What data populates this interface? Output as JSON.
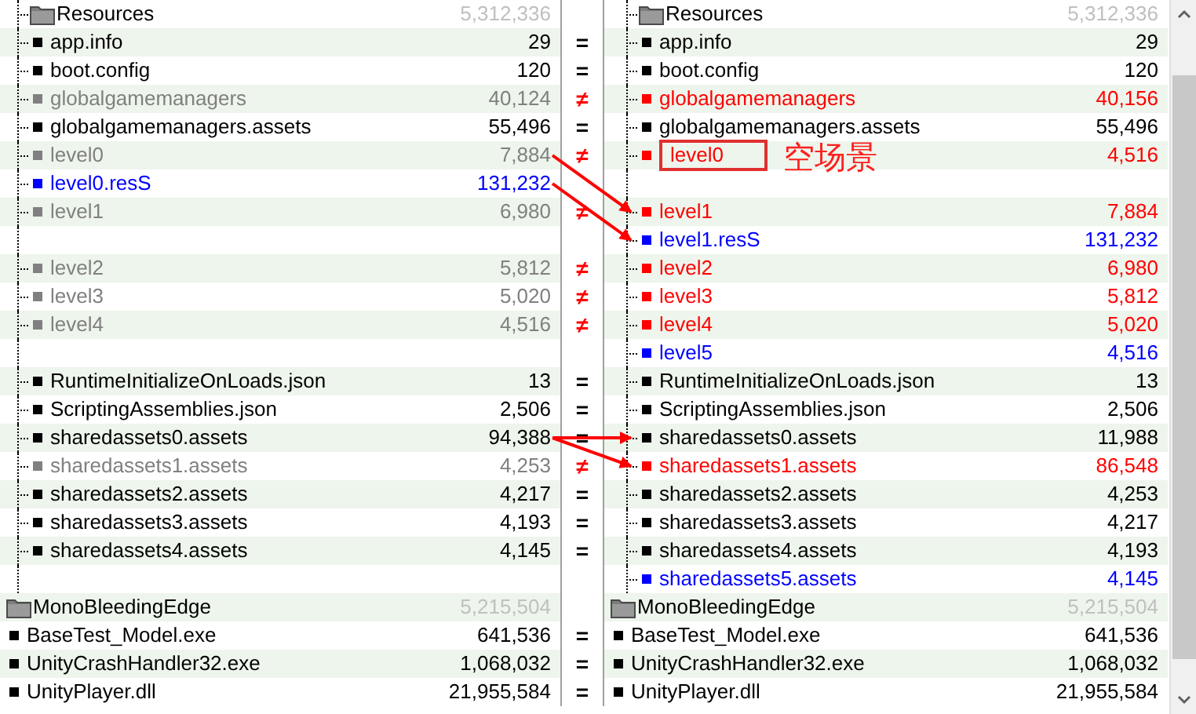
{
  "groups": [
    {
      "tree": true,
      "rows": [
        {
          "left": {
            "kind": "folder",
            "name": "Resources",
            "size": "5,312,336"
          },
          "compare": null,
          "right": {
            "kind": "folder",
            "name": "Resources",
            "size": "5,312,336"
          }
        },
        {
          "left": {
            "kind": "file",
            "name": "app.info",
            "size": "29",
            "color": "#000000"
          },
          "compare": {
            "symbol": "=",
            "differs": false
          },
          "right": {
            "kind": "file",
            "name": "app.info",
            "size": "29",
            "color": "#000000"
          }
        },
        {
          "left": {
            "kind": "file",
            "name": "boot.config",
            "size": "120",
            "color": "#000000"
          },
          "compare": {
            "symbol": "=",
            "differs": false
          },
          "right": {
            "kind": "file",
            "name": "boot.config",
            "size": "120",
            "color": "#000000"
          }
        },
        {
          "left": {
            "kind": "file",
            "name": "globalgamemanagers",
            "size": "40,124",
            "color": "#808080"
          },
          "compare": {
            "symbol": "≠",
            "differs": true
          },
          "right": {
            "kind": "file",
            "name": "globalgamemanagers",
            "size": "40,156",
            "color": "#ff0000"
          }
        },
        {
          "left": {
            "kind": "file",
            "name": "globalgamemanagers.assets",
            "size": "55,496",
            "color": "#000000"
          },
          "compare": {
            "symbol": "=",
            "differs": false
          },
          "right": {
            "kind": "file",
            "name": "globalgamemanagers.assets",
            "size": "55,496",
            "color": "#000000"
          }
        },
        {
          "left": {
            "kind": "file",
            "name": "level0",
            "size": "7,884",
            "color": "#808080"
          },
          "compare": {
            "symbol": "≠",
            "differs": true
          },
          "right": {
            "kind": "file",
            "name": "level0",
            "size": "4,516",
            "color": "#ff0000",
            "boxed": true,
            "note": "空场景"
          }
        },
        {
          "left": {
            "kind": "file",
            "name": "level0.resS",
            "size": "131,232",
            "color": "#0000ff"
          },
          "compare": null,
          "right": null
        },
        {
          "left": {
            "kind": "file",
            "name": "level1",
            "size": "6,980",
            "color": "#808080"
          },
          "compare": {
            "symbol": "≠",
            "differs": true
          },
          "right": {
            "kind": "file",
            "name": "level1",
            "size": "7,884",
            "color": "#ff0000"
          }
        },
        {
          "left": null,
          "compare": null,
          "right": {
            "kind": "file",
            "name": "level1.resS",
            "size": "131,232",
            "color": "#0000ff"
          }
        },
        {
          "left": {
            "kind": "file",
            "name": "level2",
            "size": "5,812",
            "color": "#808080"
          },
          "compare": {
            "symbol": "≠",
            "differs": true
          },
          "right": {
            "kind": "file",
            "name": "level2",
            "size": "6,980",
            "color": "#ff0000"
          }
        },
        {
          "left": {
            "kind": "file",
            "name": "level3",
            "size": "5,020",
            "color": "#808080"
          },
          "compare": {
            "symbol": "≠",
            "differs": true
          },
          "right": {
            "kind": "file",
            "name": "level3",
            "size": "5,812",
            "color": "#ff0000"
          }
        },
        {
          "left": {
            "kind": "file",
            "name": "level4",
            "size": "4,516",
            "color": "#808080"
          },
          "compare": {
            "symbol": "≠",
            "differs": true
          },
          "right": {
            "kind": "file",
            "name": "level4",
            "size": "5,020",
            "color": "#ff0000"
          }
        },
        {
          "left": null,
          "compare": null,
          "right": {
            "kind": "file",
            "name": "level5",
            "size": "4,516",
            "color": "#0000ff"
          }
        },
        {
          "left": {
            "kind": "file",
            "name": "RuntimeInitializeOnLoads.json",
            "size": "13",
            "color": "#000000"
          },
          "compare": {
            "symbol": "=",
            "differs": false
          },
          "right": {
            "kind": "file",
            "name": "RuntimeInitializeOnLoads.json",
            "size": "13",
            "color": "#000000"
          }
        },
        {
          "left": {
            "kind": "file",
            "name": "ScriptingAssemblies.json",
            "size": "2,506",
            "color": "#000000"
          },
          "compare": {
            "symbol": "=",
            "differs": false
          },
          "right": {
            "kind": "file",
            "name": "ScriptingAssemblies.json",
            "size": "2,506",
            "color": "#000000"
          }
        },
        {
          "left": {
            "kind": "file",
            "name": "sharedassets0.assets",
            "size": "94,388",
            "color": "#000000"
          },
          "compare": {
            "symbol": "=",
            "differs": false
          },
          "right": {
            "kind": "file",
            "name": "sharedassets0.assets",
            "size": "11,988",
            "color": "#000000"
          }
        },
        {
          "left": {
            "kind": "file",
            "name": "sharedassets1.assets",
            "size": "4,253",
            "color": "#808080"
          },
          "compare": {
            "symbol": "≠",
            "differs": true
          },
          "right": {
            "kind": "file",
            "name": "sharedassets1.assets",
            "size": "86,548",
            "color": "#ff0000"
          }
        },
        {
          "left": {
            "kind": "file",
            "name": "sharedassets2.assets",
            "size": "4,217",
            "color": "#000000"
          },
          "compare": {
            "symbol": "=",
            "differs": false
          },
          "right": {
            "kind": "file",
            "name": "sharedassets2.assets",
            "size": "4,253",
            "color": "#000000"
          }
        },
        {
          "left": {
            "kind": "file",
            "name": "sharedassets3.assets",
            "size": "4,193",
            "color": "#000000"
          },
          "compare": {
            "symbol": "=",
            "differs": false
          },
          "right": {
            "kind": "file",
            "name": "sharedassets3.assets",
            "size": "4,217",
            "color": "#000000"
          }
        },
        {
          "left": {
            "kind": "file",
            "name": "sharedassets4.assets",
            "size": "4,145",
            "color": "#000000"
          },
          "compare": {
            "symbol": "=",
            "differs": false
          },
          "right": {
            "kind": "file",
            "name": "sharedassets4.assets",
            "size": "4,193",
            "color": "#000000"
          }
        },
        {
          "left": null,
          "compare": null,
          "right": {
            "kind": "file",
            "name": "sharedassets5.assets",
            "size": "4,145",
            "color": "#0000ff"
          }
        }
      ]
    },
    {
      "tree": false,
      "rows": [
        {
          "left": {
            "kind": "folder",
            "name": "MonoBleedingEdge",
            "size": "5,215,504"
          },
          "compare": null,
          "right": {
            "kind": "folder",
            "name": "MonoBleedingEdge",
            "size": "5,215,504"
          }
        },
        {
          "left": {
            "kind": "file",
            "name": "BaseTest_Model.exe",
            "size": "641,536",
            "color": "#000000"
          },
          "compare": {
            "symbol": "=",
            "differs": false
          },
          "right": {
            "kind": "file",
            "name": "BaseTest_Model.exe",
            "size": "641,536",
            "color": "#000000"
          }
        },
        {
          "left": {
            "kind": "file",
            "name": "UnityCrashHandler32.exe",
            "size": "1,068,032",
            "color": "#000000"
          },
          "compare": {
            "symbol": "=",
            "differs": false
          },
          "right": {
            "kind": "file",
            "name": "UnityCrashHandler32.exe",
            "size": "1,068,032",
            "color": "#000000"
          }
        },
        {
          "left": {
            "kind": "file",
            "name": "UnityPlayer.dll",
            "size": "21,955,584",
            "color": "#000000"
          },
          "compare": {
            "symbol": "=",
            "differs": false
          },
          "right": {
            "kind": "file",
            "name": "UnityPlayer.dll",
            "size": "21,955,584",
            "color": "#000000"
          }
        }
      ]
    }
  ]
}
